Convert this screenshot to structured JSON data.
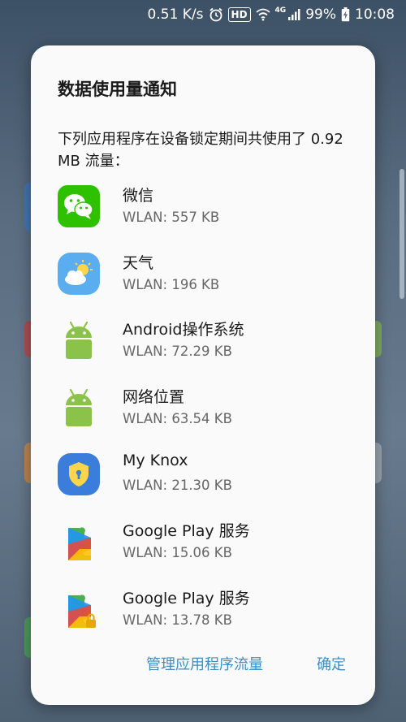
{
  "status_bar": {
    "speed": "0.51 K/s",
    "hd": "HD",
    "network": "4G",
    "battery": "99%",
    "time": "10:08"
  },
  "dialog": {
    "title": "数据使用量通知",
    "message": "下列应用程序在设备锁定期间共使用了 0.92 MB 流量：",
    "apps": [
      {
        "name": "微信",
        "usage": "WLAN: 557 KB",
        "icon": "wechat-icon"
      },
      {
        "name": "天气",
        "usage": "WLAN: 196 KB",
        "icon": "weather-icon"
      },
      {
        "name": "Android操作系统",
        "usage": "WLAN: 72.29 KB",
        "icon": "android-icon"
      },
      {
        "name": "网络位置",
        "usage": "WLAN: 63.54 KB",
        "icon": "android-icon"
      },
      {
        "name": "My Knox",
        "usage": "WLAN: 21.30 KB",
        "icon": "knox-icon"
      },
      {
        "name": "Google Play 服务",
        "usage": "WLAN: 15.06 KB",
        "icon": "google-play-services-icon"
      },
      {
        "name": "Google Play 服务",
        "usage": "WLAN: 13.78 KB",
        "icon": "google-play-services-icon"
      }
    ],
    "actions": {
      "manage": "管理应用程序流量",
      "ok": "确定"
    }
  }
}
